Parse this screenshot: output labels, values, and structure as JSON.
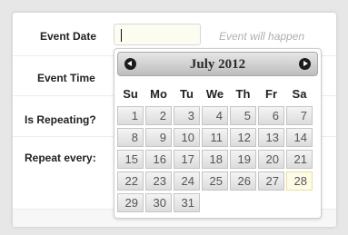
{
  "form": {
    "event_date_label": "Event Date",
    "event_date_value": "",
    "event_date_hint": "Event will happen",
    "event_time_label": "Event Time",
    "is_repeating_label": "Is Repeating?",
    "repeat_every_label": "Repeat every:"
  },
  "datepicker": {
    "title": "July 2012",
    "prev_icon": "chevron-left-icon",
    "next_icon": "chevron-right-icon",
    "weekdays": [
      "Su",
      "Mo",
      "Tu",
      "We",
      "Th",
      "Fr",
      "Sa"
    ],
    "weeks": [
      [
        "1",
        "2",
        "3",
        "4",
        "5",
        "6",
        "7"
      ],
      [
        "8",
        "9",
        "10",
        "11",
        "12",
        "13",
        "14"
      ],
      [
        "15",
        "16",
        "17",
        "18",
        "19",
        "20",
        "21"
      ],
      [
        "22",
        "23",
        "24",
        "25",
        "26",
        "27",
        "28"
      ],
      [
        "29",
        "30",
        "31"
      ]
    ],
    "highlighted_day": "28",
    "colors": {
      "header_top": "#e6e6e6",
      "header_bottom": "#bdbdbd",
      "day_bg": "#e6e6e6",
      "highlight_bg": "#fdfbe6"
    }
  }
}
